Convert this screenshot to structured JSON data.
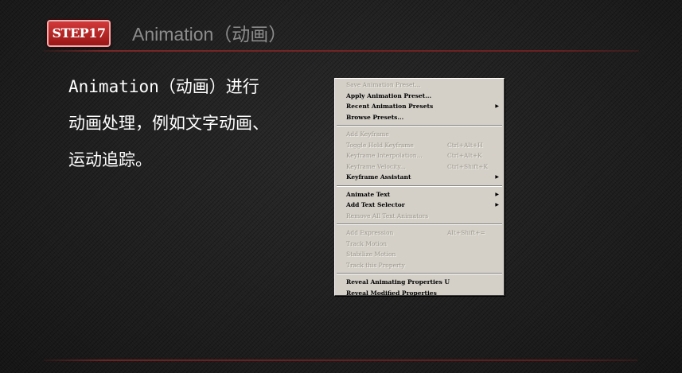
{
  "step": {
    "badge": "STEP17",
    "title": "Animation（动画）"
  },
  "description": [
    "Animation（动画）进行",
    "动画处理，例如文字动画、",
    "运动追踪。"
  ],
  "menu": {
    "groups": [
      [
        {
          "label": "Save Animation Preset...",
          "enabled": false
        },
        {
          "label": "Apply Animation Preset...",
          "enabled": true
        },
        {
          "label": "Recent Animation Presets",
          "enabled": true,
          "submenu": true
        },
        {
          "label": "Browse Presets...",
          "enabled": true
        }
      ],
      [
        {
          "label": "Add Keyframe",
          "enabled": false
        },
        {
          "label": "Toggle Hold Keyframe",
          "shortcut": "Ctrl+Alt+H",
          "enabled": false
        },
        {
          "label": "Keyframe Interpolation...",
          "shortcut": "Ctrl+Alt+K",
          "enabled": false
        },
        {
          "label": "Keyframe Velocity...",
          "shortcut": "Ctrl+Shift+K",
          "enabled": false
        },
        {
          "label": "Keyframe Assistant",
          "enabled": true,
          "submenu": true
        }
      ],
      [
        {
          "label": "Animate Text",
          "enabled": true,
          "submenu": true
        },
        {
          "label": "Add Text Selector",
          "enabled": true,
          "submenu": true
        },
        {
          "label": "Remove All Text Animators",
          "enabled": false
        }
      ],
      [
        {
          "label": "Add Expression",
          "shortcut": "Alt+Shift+=",
          "enabled": false
        },
        {
          "label": "Track Motion",
          "enabled": false
        },
        {
          "label": "Stabilize Motion",
          "enabled": false
        },
        {
          "label": "Track this Property",
          "enabled": false
        }
      ],
      [
        {
          "label": "Reveal Animating Properties",
          "shortcut": "U",
          "enabled": true
        },
        {
          "label": "Reveal Modified Properties",
          "enabled": true
        }
      ]
    ]
  },
  "colors": {
    "accent_red": "#b22222",
    "title_gray": "#8c8c8c",
    "menu_bg": "#d4d0c8",
    "background": "#1f1f1f"
  }
}
